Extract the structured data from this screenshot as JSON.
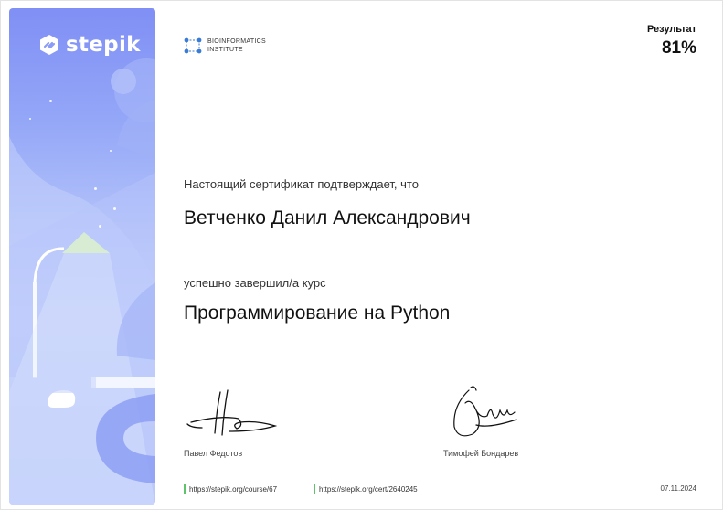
{
  "brand": {
    "logo_text": "stepik"
  },
  "partner": {
    "line1": "BIOINFORMATICS",
    "line2": "INSTITUTE"
  },
  "result": {
    "label": "Результат",
    "value": "81%"
  },
  "certificate": {
    "confirm_text": "Настоящий сертификат подтверждает, что",
    "recipient_name": "Ветченко Данил Александрович",
    "completed_text": "успешно завершил/а  курс",
    "course_title": "Программирование на Python"
  },
  "signatures": [
    {
      "name": "Павел Федотов"
    },
    {
      "name": "Тимофей Бондарев"
    }
  ],
  "footer": {
    "course_link": "https://stepik.org/course/67",
    "cert_link": "https://stepik.org/cert/2640245",
    "date": "07.11.2024"
  },
  "colors": {
    "accent_green": "#5fc36b",
    "panel_blue": "#8b9cf6",
    "partner_blue": "#3a7bd5"
  }
}
